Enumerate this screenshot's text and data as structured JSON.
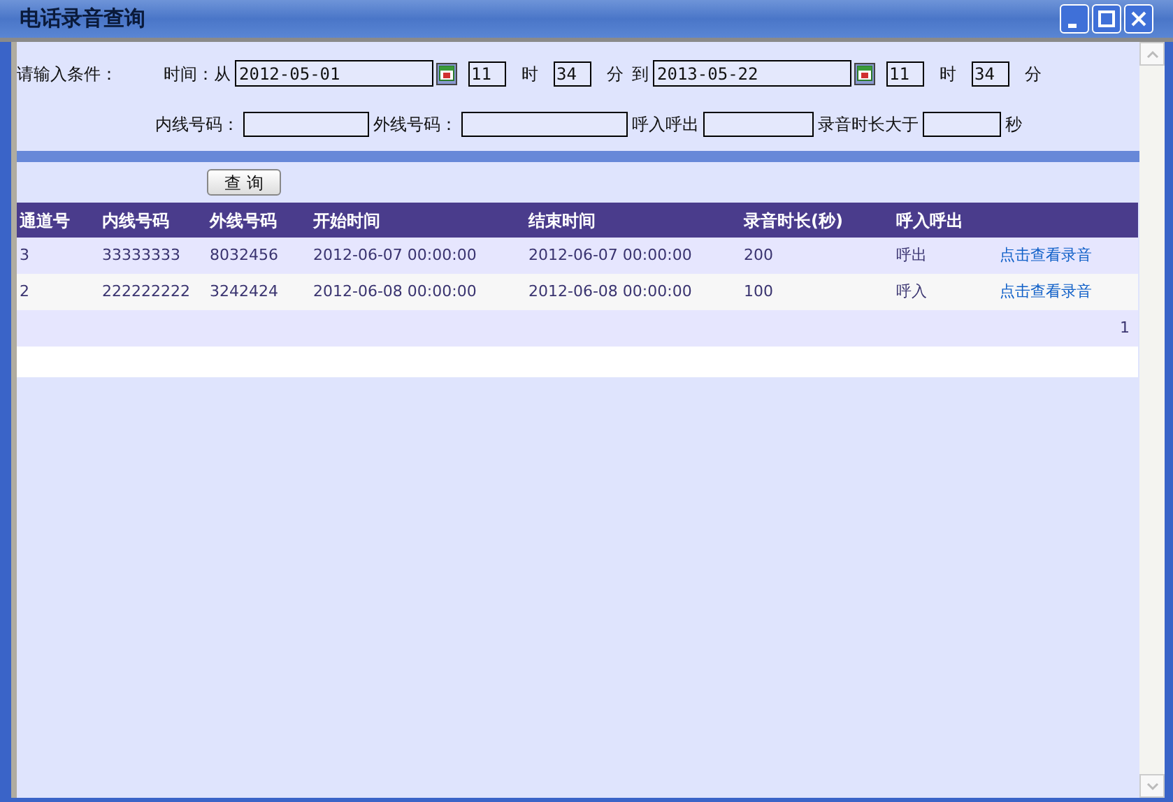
{
  "window": {
    "title": "电话录音查询"
  },
  "filter": {
    "label": "请输入条件：",
    "row_1": [
      {
        "kind": "text",
        "text": "时间：从"
      },
      {
        "kind": "date",
        "value": "2012-05-01"
      },
      {
        "kind": "short",
        "value": "11"
      },
      {
        "kind": "text",
        "text": "时"
      },
      {
        "kind": "short",
        "value": "34"
      },
      {
        "kind": "text",
        "text": "分"
      },
      {
        "kind": "text",
        "text": "到"
      },
      {
        "kind": "date",
        "value": "2013-05-22"
      },
      {
        "kind": "short",
        "value": "11"
      },
      {
        "kind": "text",
        "text": "时"
      },
      {
        "kind": "short",
        "value": "34"
      },
      {
        "kind": "text",
        "text": "分"
      }
    ],
    "row_2": [
      {
        "kind": "text",
        "text": "内线号码："
      },
      {
        "kind": "field"
      },
      {
        "kind": "text",
        "text": "外线号码："
      },
      {
        "kind": "field"
      },
      {
        "kind": "text",
        "text": "呼入呼出"
      },
      {
        "kind": "field"
      },
      {
        "kind": "text",
        "text": "录音时长大于"
      },
      {
        "kind": "field"
      },
      {
        "kind": "text",
        "text": "秒"
      }
    ]
  },
  "query_button": "查 询",
  "table": {
    "columns": [
      "通道号",
      "内线号码",
      "外线号码",
      "开始时间",
      "结束时间",
      "录音时长(秒)",
      "呼入呼出"
    ],
    "rows": [
      {
        "cells": [
          "3",
          "33333333",
          "8032456",
          "2012-06-07 00:00:00",
          "2012-06-07 00:00:00",
          "200",
          "呼出"
        ],
        "link": "点击查看录音"
      },
      {
        "cells": [
          "2",
          "222222222",
          "3242424",
          "2012-06-08 00:00:00",
          "2012-06-08 00:00:00",
          "100",
          "呼入"
        ],
        "link": "点击查看录音"
      }
    ],
    "pager": "1"
  }
}
